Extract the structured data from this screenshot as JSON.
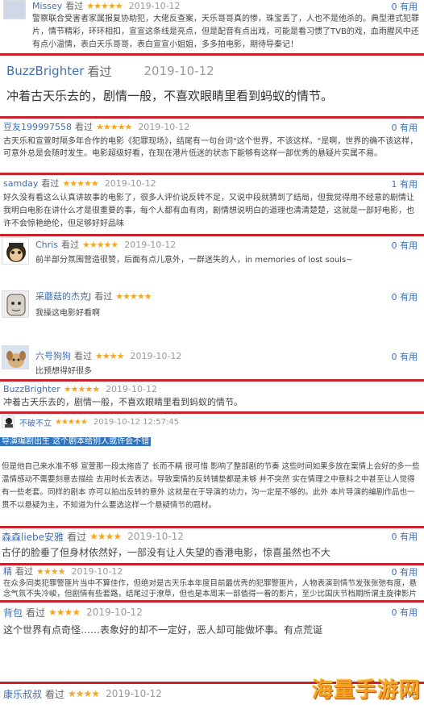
{
  "common": {
    "seen": "看过",
    "useful_suffix": "有用"
  },
  "reviews": [
    {
      "user": "Missey",
      "stars": "★★★★★",
      "date": "2019-10-12",
      "useful": "0",
      "text": "警察联合受害者家属报复协助犯，大佬反查案，天乐哥哥真的惨，珠宝丢了，人也不是他杀的。典型港式犯罪片，情节精彩，环环相扣，宣宣这条线是亮点，但是配音有点出戏，可能是看习惯了TVB的戏，血雨腥风中还有点小温情，表白天乐哥哥，表白宣宣小姐姐，多多拍电影，期待导秦记！"
    },
    {
      "user": "BuzzBrighter",
      "stars": "",
      "date": "2019-10-12",
      "useful": "",
      "text": "冲着古天乐去的，剧情一般，不喜欢眼睛里看到蚂蚁的情节。"
    },
    {
      "user": "豆友199997558",
      "stars": "★★★★★",
      "date": "2019-10-12",
      "useful": "0",
      "text": "古天乐和宣萱时隔多年合作的电影《犯罪现场》，结尾有一句台词\"这个世界，不该这样。\"是啊，世界的确不该这样，可意外总是会随时发生。电影超级好看，在现在港片低迷的状态下能够有这样一部优秀的悬疑片实属不易。"
    },
    {
      "user": "samday",
      "stars": "★★★★★",
      "date": "2019-10-12",
      "useful": "1",
      "text": "好久没有看这么认真讲故事的电影了，很多人评价说反转不足，又说中段就猜到了结局，但我觉得用不经意的剧情让我明白电影在讲什么才是很重要的事，每个人都有血有肉，剧情想说明白的道理也清清楚楚，这就是一部好电影，也许不会惊艳绝伦，但足够好好品味"
    },
    {
      "user": "Chris",
      "stars": "★★★★★",
      "date": "2019-10-12",
      "useful": "0",
      "text": "前半部分氛围营造很赞，后面有点儿意外，一群迷失的人，in memories of lost souls~"
    },
    {
      "user": "采蘑菇的杰克J",
      "stars": "★★★★★",
      "date": "2019-10-12",
      "useful": "0",
      "text": "我操这电影好看啊"
    },
    {
      "user": "六号狗狗",
      "stars": "★★★★",
      "date": "2019-10-12",
      "useful": "0",
      "text": "比预想得好很多"
    },
    {
      "user": "BuzzBrighter",
      "stars": "★★★★★",
      "date": "2019-10-12",
      "useful": "",
      "text": "冲着古天乐去的，剧情一般，不喜欢眼睛里看到蚂蚁的情节。"
    },
    {
      "user": "不破不立",
      "stars": "★★★★★",
      "date": "2019-10-12 12:57:45",
      "useful": "",
      "highlight": "导演编剧出生 这个剧本给别人或许会不错",
      "text": "但是他自己来水准不够 宣萱那一段太拖沓了 长而不精 很可惜 影响了整部剧的节奏 这些时间如果多放在案情上会好的多一些温情感动不需要刻意去描绘 去用时长去表达。导致案情的反转铺垫都是未够 并不突然 实在情理之中意料之中甚至让人觉得有一些老套。同样的剧本 亦可以拍出反转的意外 这就是在于导演的功力，沟一定是不够的。此外 本片导演的编剧作品也一贯不以悬疑为主，不知道为什么要选这样一个悬疑情节的题材。"
    },
    {
      "user": "森森liebe安雅",
      "stars": "★★★★",
      "date": "2019-10-12",
      "useful": "0",
      "text": "古仔的脸垂了但身材依然好，一部没有让人失望的香港电影，惊喜虽然也不大"
    },
    {
      "user": "精",
      "stars": "★★★★",
      "date": "2019-10-12",
      "useful": "0",
      "text": "在众多同类犯罪警匪片当中不算佳作，但绝对是古天乐本年度目前最优秀的犯罪警匪片，人物表演到情节发张张弛有度，悬念气氛不失冷峻，但剧情有些套路，结尾过于潦草，但也是本周末一部值得一看的影片，至少比国庆节档期所谓主旋律影片有意思。"
    },
    {
      "user": "背包",
      "stars": "★★★★",
      "date": "2019-10-12",
      "useful": "0",
      "text": "这个世界有点奇怪……表象好的却不一定好，恶人却可能做坏事。有点荒诞"
    },
    {
      "user": "康乐叔叔",
      "stars": "★★★★",
      "date": "2019-10-12",
      "useful": "0",
      "text": ""
    }
  ],
  "watermark": "海量手游网",
  "colors": {
    "accent_red": "#c8232c",
    "link_blue": "#3f6fb4",
    "star": "#f5a623",
    "highlight_bg": "#2f74c0"
  },
  "avatars": [
    "dark-hair-figure-icon",
    "cartoon-man-icon",
    "puppy-icon",
    "monkey-icon"
  ]
}
